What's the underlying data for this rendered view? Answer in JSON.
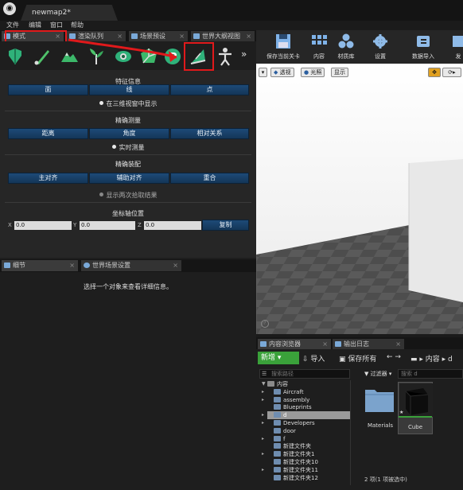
{
  "window": {
    "tab_title": "newmap2*"
  },
  "menu": [
    "文件",
    "编辑",
    "窗口",
    "帮助"
  ],
  "left_tabs": [
    {
      "label": "模式"
    },
    {
      "label": "渲染队列"
    },
    {
      "label": "场景预设"
    },
    {
      "label": "世界大纲视图"
    }
  ],
  "mode_icons": [
    "place-icon",
    "paint-icon",
    "landscape-icon",
    "foliage-icon",
    "eye-icon",
    "geometry-icon",
    "plugin-p-icon",
    "custom-mode-icon",
    "figure-icon"
  ],
  "feature": {
    "title": "特征信息",
    "buttons": [
      "面",
      "线",
      "点"
    ],
    "radio": "在三维视窗中显示"
  },
  "measure": {
    "title": "精确测量",
    "buttons": [
      "距离",
      "角度",
      "相对关系"
    ],
    "radio": "实时测量"
  },
  "assembly": {
    "title": "精确装配",
    "buttons": [
      "主对齐",
      "辅助对齐",
      "重合"
    ],
    "radio": "显示两次拾取结果"
  },
  "coords": {
    "title": "坐标轴位置",
    "x_label": "X",
    "x_value": "0.0",
    "y_label": "Y",
    "y_value": "0.0",
    "z_label": "Z",
    "z_value": "0.0",
    "copy": "复制"
  },
  "details": {
    "tabs": [
      "细节",
      "世界场景设置"
    ],
    "empty_message": "选择一个对象来查看详细信息。"
  },
  "toolbar": {
    "save": "保存当前关卡",
    "content": "内容",
    "materials": "材质库",
    "settings": "设置",
    "data_import": "数据导入",
    "publish": "发"
  },
  "viewport": {
    "perspective": "透视",
    "lit": "光照",
    "show": "显示"
  },
  "content_browser": {
    "tabs": [
      "内容浏览器",
      "输出日志"
    ],
    "new": "新增",
    "import": "导入",
    "save_all": "保存所有",
    "path": [
      "内容",
      "d"
    ],
    "search_placeholder": "搜索路径",
    "filter": "过滤器",
    "asset_search": "搜索 d",
    "tree": [
      {
        "label": "内容",
        "level": 0,
        "arrow": "▼"
      },
      {
        "label": "Aircraft",
        "level": 1,
        "arrow": "▸"
      },
      {
        "label": "assembly",
        "level": 1,
        "arrow": "▸"
      },
      {
        "label": "Blueprints",
        "level": 1,
        "arrow": ""
      },
      {
        "label": "d",
        "level": 1,
        "arrow": "▸",
        "selected": true
      },
      {
        "label": "Developers",
        "level": 1,
        "arrow": "▸"
      },
      {
        "label": "door",
        "level": 1,
        "arrow": ""
      },
      {
        "label": "f",
        "level": 1,
        "arrow": "▸"
      },
      {
        "label": "新建文件夹",
        "level": 1,
        "arrow": ""
      },
      {
        "label": "新建文件夹1",
        "level": 1,
        "arrow": "▸"
      },
      {
        "label": "新建文件夹10",
        "level": 1,
        "arrow": ""
      },
      {
        "label": "新建文件夹11",
        "level": 1,
        "arrow": "▸"
      },
      {
        "label": "新建文件夹12",
        "level": 1,
        "arrow": ""
      }
    ],
    "assets": [
      "Materials",
      "Cube"
    ],
    "status": "2 项(1 项被选中)"
  },
  "colors": {
    "accent_red": "#e0191b",
    "button_blue": "#1d4a77",
    "new_green": "#3aa13a"
  }
}
